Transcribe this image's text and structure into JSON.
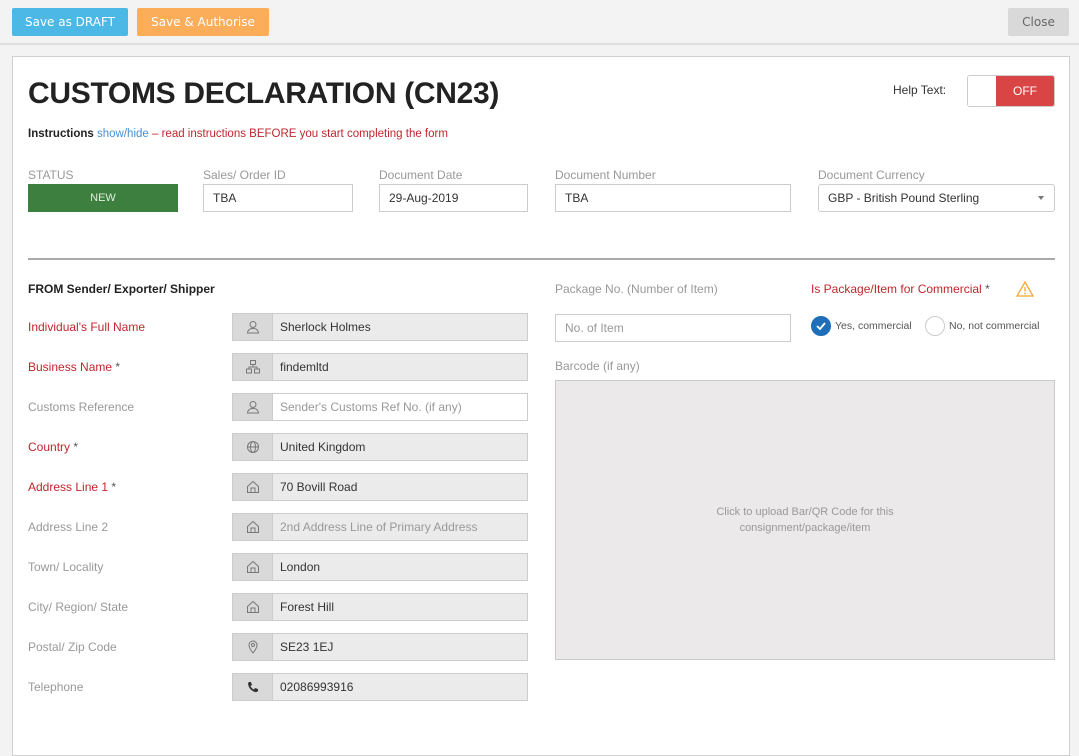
{
  "toolbar": {
    "save_draft_label": "Save as DRAFT",
    "save_authorise_label": "Save & Authorise",
    "close_label": "Close"
  },
  "colors": {
    "draft": "#4bb8e6",
    "authorise": "#fcad5a",
    "status_new": "#3d7f3e",
    "required_red": "#c0262d",
    "toggle_off": "#d94545",
    "radio_checked": "#1e6fb8"
  },
  "header": {
    "title": "CUSTOMS DECLARATION (CN23)",
    "help_text_label": "Help Text:",
    "help_toggle_state": "OFF",
    "instructions_label": "Instructions",
    "instructions_link": "show/hide",
    "instructions_note": " – read instructions BEFORE you start completing the form"
  },
  "document": {
    "status_label": "STATUS",
    "status_value": "NEW",
    "order_id_label": "Sales/ Order ID",
    "order_id_value": "TBA",
    "date_label": "Document Date",
    "date_value": "29-Aug-2019",
    "number_label": "Document Number",
    "number_value": "TBA",
    "currency_label": "Document Currency",
    "currency_value": "GBP - British Pound Sterling"
  },
  "sender": {
    "section_title": "FROM Sender/ Exporter/ Shipper",
    "fields": [
      {
        "label": "Individual's Full Name",
        "required": false,
        "icon": "user-icon",
        "value": "Sherlock Holmes",
        "placeholder": ""
      },
      {
        "label": "Business Name",
        "required": true,
        "icon": "organization-icon",
        "value": "findemltd",
        "placeholder": ""
      },
      {
        "label": "Customs Reference",
        "required": false,
        "icon": "user-icon",
        "value": "",
        "placeholder": "Sender's Customs Ref No. (if any)"
      },
      {
        "label": "Country",
        "required": true,
        "icon": "globe-icon",
        "value": "United Kingdom",
        "placeholder": ""
      },
      {
        "label": "Address Line 1",
        "required": true,
        "icon": "home-icon",
        "value": "70 Bovill Road",
        "placeholder": ""
      },
      {
        "label": "Address Line 2",
        "required": false,
        "icon": "home-icon",
        "value": "",
        "placeholder": "2nd Address Line of Primary Address"
      },
      {
        "label": "Town/ Locality",
        "required": false,
        "icon": "home-icon",
        "value": "London",
        "placeholder": ""
      },
      {
        "label": "City/ Region/ State",
        "required": false,
        "icon": "home-icon",
        "value": "Forest Hill",
        "placeholder": ""
      },
      {
        "label": "Postal/ Zip Code",
        "required": false,
        "icon": "map-pin-icon",
        "value": "SE23 1EJ",
        "placeholder": ""
      },
      {
        "label": "Telephone",
        "required": false,
        "icon": "phone-icon",
        "value": "02086993916",
        "placeholder": ""
      }
    ],
    "required_star": "*"
  },
  "package": {
    "package_no_label": "Package No. (Number of Item)",
    "package_no_placeholder": "No. of Item",
    "commercial_label": "Is Package/Item for Commercial",
    "commercial_options": [
      "Yes, commercial",
      "No, not commercial"
    ],
    "commercial_selected": "Yes, commercial",
    "barcode_label": "Barcode (if any)",
    "barcode_upload_text": "Click to upload Bar/QR Code for this consignment/package/item"
  }
}
